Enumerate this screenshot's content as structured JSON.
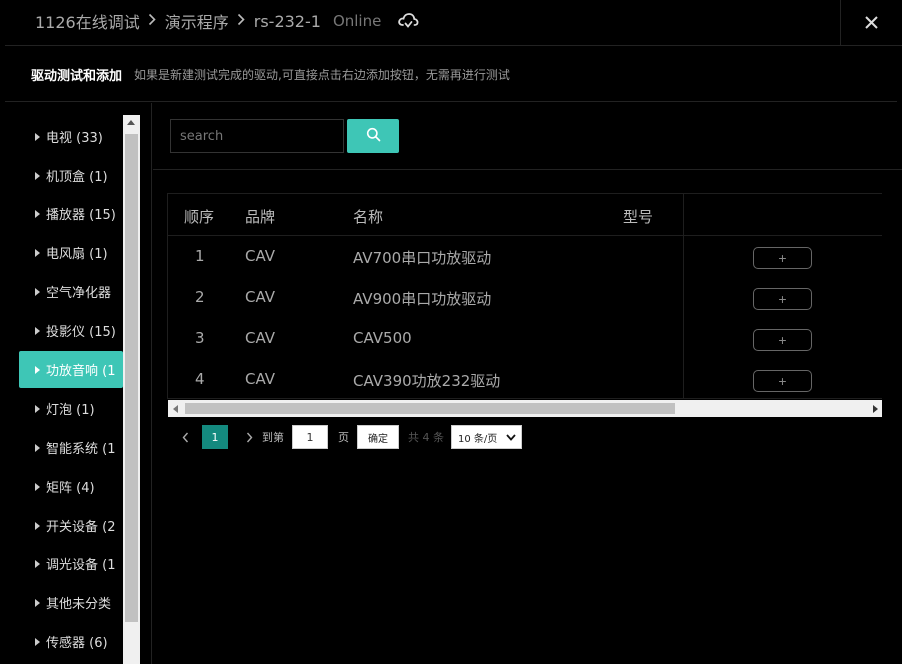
{
  "header": {
    "breadcrumbs": [
      "1126在线调试",
      "演示程序",
      "rs-232-1"
    ],
    "status": "Online",
    "icons": {
      "cloud": "cloud-sync-icon",
      "close": "close-icon",
      "separator": "chevron-right-icon"
    }
  },
  "subbar": {
    "title": "驱动测试和添加",
    "hint": "如果是新建测试完成的驱动,可直接点击右边添加按钮，无需再进行测试"
  },
  "sidebar": {
    "items": [
      {
        "label": "电视 (33)"
      },
      {
        "label": "机顶盒 (1)"
      },
      {
        "label": "播放器 (15)"
      },
      {
        "label": "电风扇 (1)"
      },
      {
        "label": "空气净化器"
      },
      {
        "label": "投影仪 (15)"
      },
      {
        "label": "功放音响 (1",
        "active": true
      },
      {
        "label": "灯泡 (1)"
      },
      {
        "label": "智能系统 (1"
      },
      {
        "label": "矩阵 (4)"
      },
      {
        "label": "开关设备 (2"
      },
      {
        "label": "调光设备 (1"
      },
      {
        "label": "其他未分类"
      },
      {
        "label": "传感器 (6)"
      }
    ]
  },
  "search": {
    "placeholder": "search",
    "value": "",
    "icon": "search-icon"
  },
  "table": {
    "columns": [
      "顺序",
      "品牌",
      "名称",
      "型号"
    ],
    "add_label": "+",
    "rows": [
      {
        "index": "1",
        "brand": "CAV",
        "name": "AV700串口功放驱动",
        "model": ""
      },
      {
        "index": "2",
        "brand": "CAV",
        "name": "AV900串口功放驱动",
        "model": ""
      },
      {
        "index": "3",
        "brand": "CAV",
        "name": "CAV500",
        "model": ""
      },
      {
        "index": "4",
        "brand": "CAV",
        "name": "CAV390功放232驱动",
        "model": ""
      }
    ]
  },
  "pagination": {
    "current_page": "1",
    "goto_label": "到第",
    "goto_value": "1",
    "page_suffix": "页",
    "confirm_label": "确定",
    "total_label": "共 4 条",
    "page_size": "10 条/页"
  },
  "colors": {
    "accent": "#3ec6b6",
    "page_active": "#148a7f",
    "background": "#000000"
  }
}
